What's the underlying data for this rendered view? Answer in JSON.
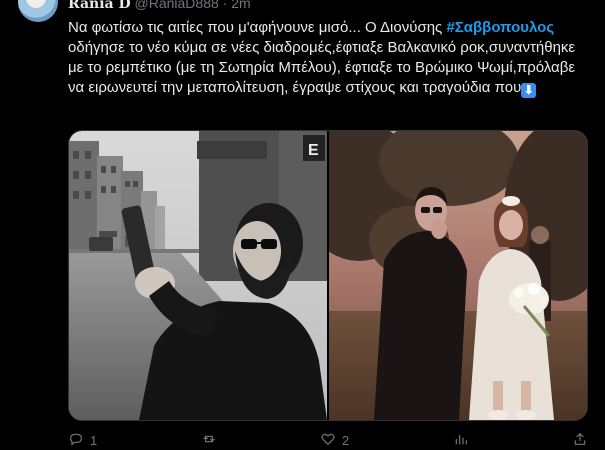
{
  "post": {
    "author_name": "Rania D",
    "author_handle": "@RaniaD888",
    "separator": "·",
    "time": "2m",
    "text_before": "Να φωτίσω τις αιτίες που μ'αφήνουνε μισό... Ο Διονύσης ",
    "hashtag": "#Σαββοπουλος",
    "text_after": " οδήγησε το νέο κύμα σε νέες διαδρομές,έφτιαξε Βαλκανικό ροκ,συναντήθηκε με το ρεμπέτικο (με τη Σωτηρία Μπέλου), έφτιαξε το Βρώμικο Ψωμί,πρόλαβε να ειρωνευτεί την μεταπολίτευση, έγραψε στίχους και τραγούδια που",
    "emoji": "⬇"
  },
  "media": {
    "left_sign_letter": "E"
  },
  "actions": {
    "reply_count": "1",
    "like_count": "2"
  },
  "colors": {
    "background": "#000000",
    "text": "#e7e9ea",
    "muted": "#71767b",
    "hashtag": "#1d9bf0"
  }
}
